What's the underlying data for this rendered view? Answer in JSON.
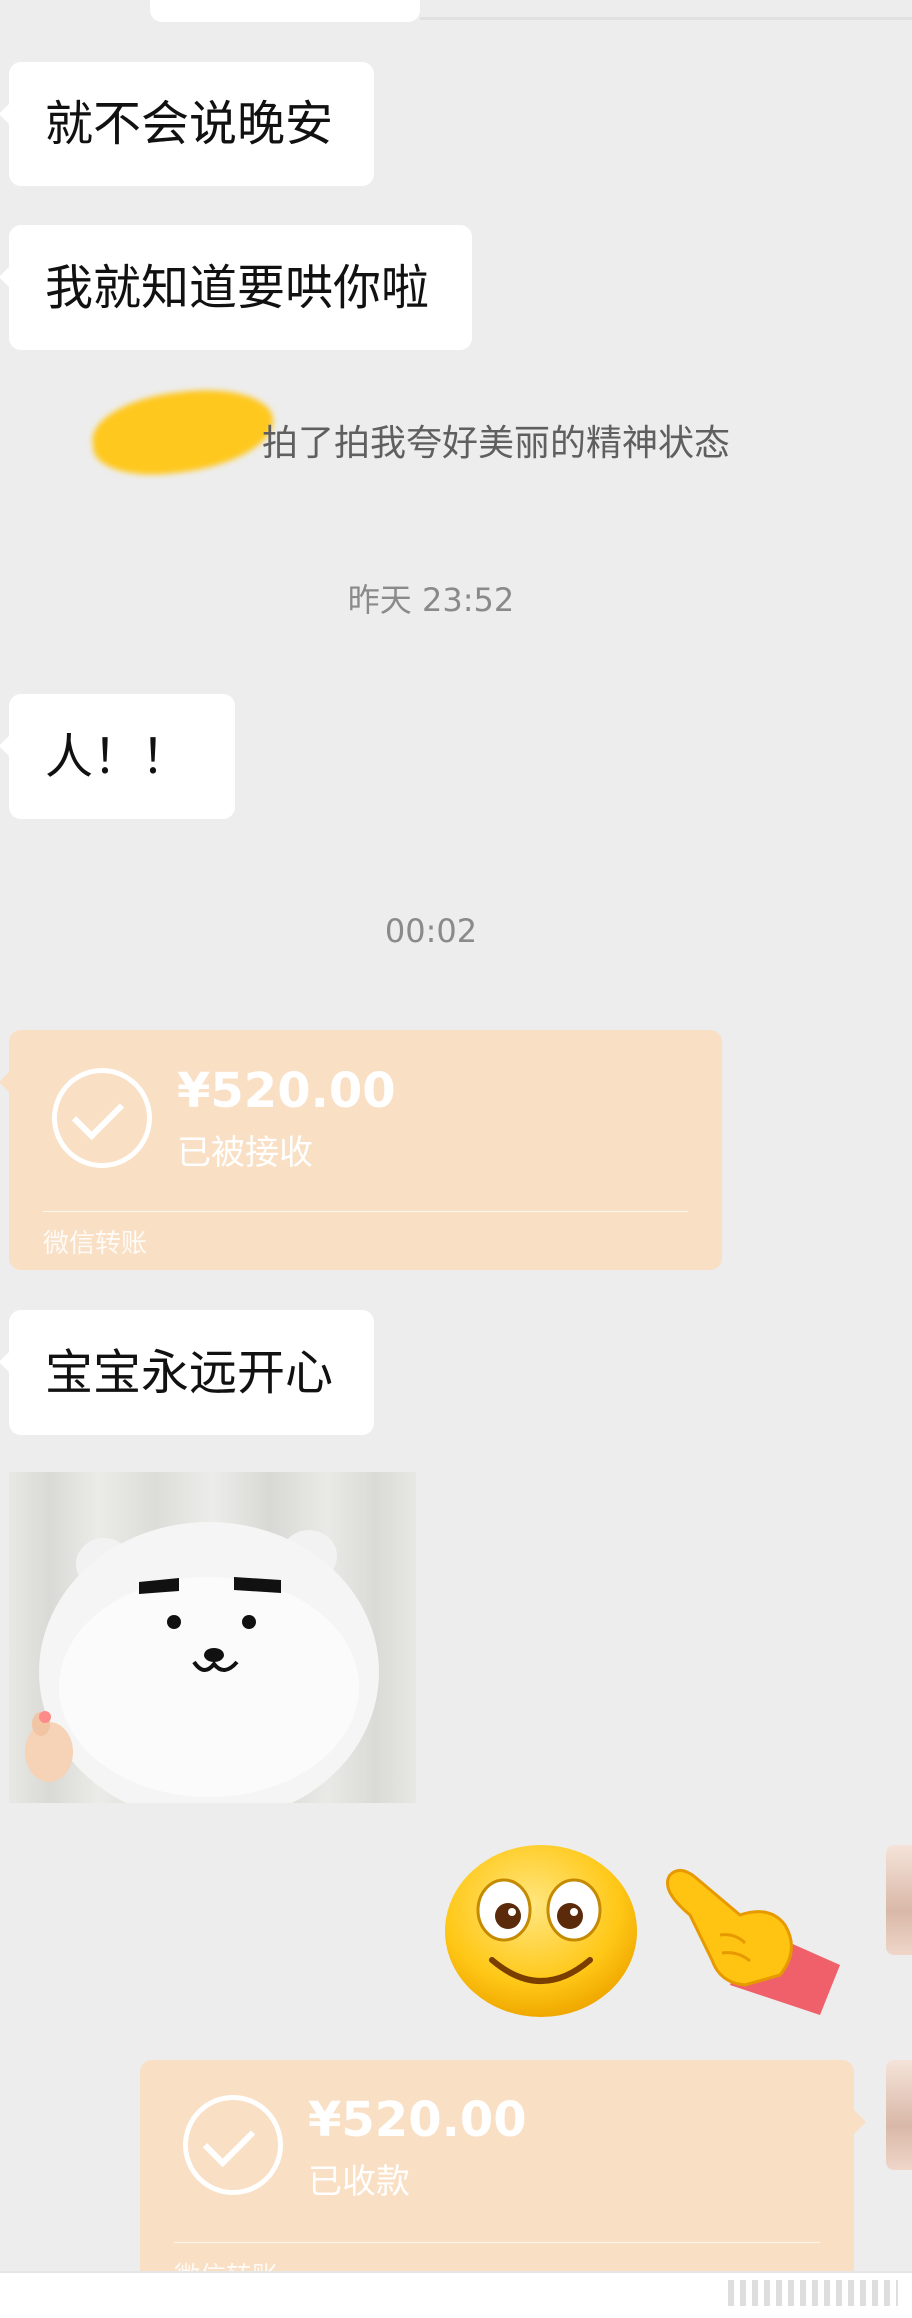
{
  "messages": {
    "m1": "就不会说晚安",
    "m2": "我就知道要哄你啦",
    "pat_text": "拍了拍我夸好美丽的精神状态",
    "time1": "昨天 23:52",
    "m3": "人！！",
    "time2": "00:02",
    "m4": "宝宝永远开心"
  },
  "transfer_received": {
    "amount": "¥520.00",
    "status": "已被接收",
    "brand": "微信转账"
  },
  "transfer_collected": {
    "amount": "¥520.00",
    "status": "已收款",
    "brand": "微信转账"
  },
  "icons": {
    "sticker": "bear-sticker",
    "emoji1": "smiling-face-emoji",
    "emoji2": "pointing-hand-emoji"
  },
  "colors": {
    "background": "#ededed",
    "bubble": "#ffffff",
    "transfer": "#f9dfc4",
    "redaction": "#ffc81e"
  }
}
